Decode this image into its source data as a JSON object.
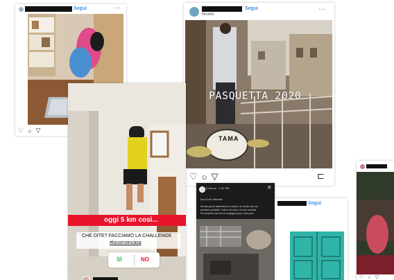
{
  "post_yoga": {
    "follow_label": "Segui",
    "menu_icon": "more-icon",
    "actions": [
      "heart-icon",
      "comment-icon",
      "send-icon",
      "bookmark-icon"
    ]
  },
  "post_balcony": {
    "follow_label": "Segui",
    "subtext": "Modello",
    "overlay_text": "PASQUETTA 2020",
    "drum_brand": "TAMA",
    "menu_icon": "more-icon",
    "actions": [
      "heart-icon",
      "comment-icon",
      "send-icon",
      "bookmark-icon"
    ]
  },
  "story_run": {
    "banner_text": "oggi 5 km così...",
    "question_line1": "CHE DITE? FACCIAMO LA CHALLENGE",
    "hashtag": "#iocorroincasa",
    "poll_yes": "SÌ",
    "poll_no": "NO",
    "accent_color": "#e8142b"
  },
  "story_mess": {
    "header": "Il Giorno · 1.02 PM",
    "caption_line1": "Ecco il mio disordine",
    "caption_line2": "Da due giorni sistemiamo la casa in un modo che non",
    "caption_line3": "pensavo possibile. Tutto è un caos, un vero macello",
    "caption_line4": "Ho scoperto che me ne vergogno poco. Non puoi"
  },
  "post_doors": {
    "follow_label": "Segui"
  },
  "post_right": {
    "actions": [
      "heart-icon",
      "comment-icon",
      "send-icon"
    ]
  }
}
